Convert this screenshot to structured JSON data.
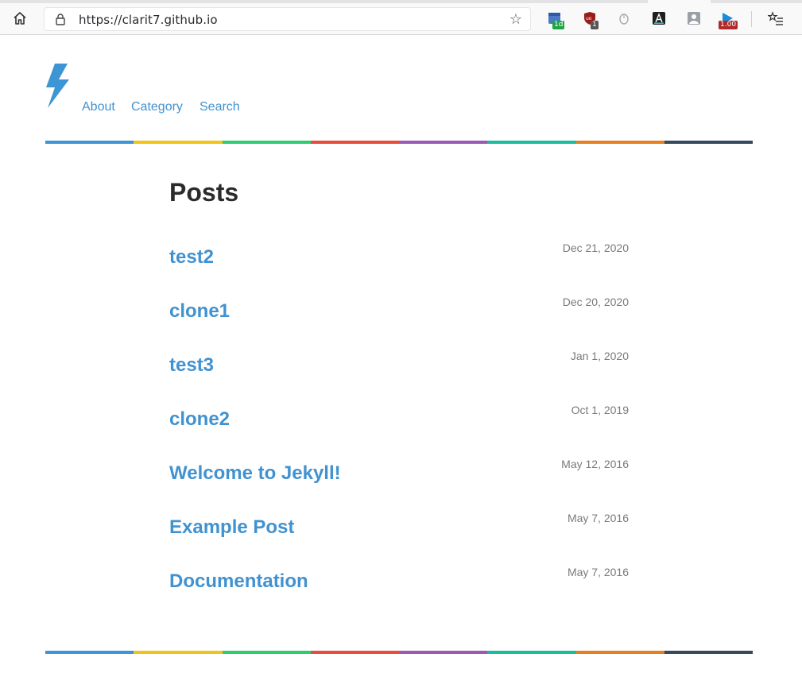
{
  "browser": {
    "url": "https://clarit7.github.io",
    "extensions": [
      {
        "name": "calendar-extension-icon",
        "badge": "1d",
        "badge_color": "#1ea446"
      },
      {
        "name": "ublock-icon",
        "badge": "1",
        "badge_color": "#555555"
      },
      {
        "name": "mouse-gesture-icon",
        "badge": ""
      },
      {
        "name": "dark-reader-icon",
        "badge": ""
      },
      {
        "name": "profile-extension-icon",
        "badge": ""
      },
      {
        "name": "video-speed-icon",
        "badge": "1.00",
        "badge_color": "#b02a2a"
      }
    ]
  },
  "site": {
    "brand_color": "#4192d0",
    "nav": [
      "About",
      "Category",
      "Search"
    ],
    "rainbow": [
      "#3d95d3",
      "#f0c419",
      "#2ecc71",
      "#e74c3c",
      "#9b59b6",
      "#1abc9c",
      "#e67e22",
      "#34495e"
    ]
  },
  "main": {
    "heading": "Posts",
    "posts": [
      {
        "title": "test2",
        "date": "Dec 21, 2020"
      },
      {
        "title": "clone1",
        "date": "Dec 20, 2020"
      },
      {
        "title": "test3",
        "date": "Jan 1, 2020"
      },
      {
        "title": "clone2",
        "date": "Oct 1, 2019"
      },
      {
        "title": "Welcome to Jekyll!",
        "date": "May 12, 2016"
      },
      {
        "title": "Example Post",
        "date": "May 7, 2016"
      },
      {
        "title": "Documentation",
        "date": "May 7, 2016"
      }
    ]
  }
}
